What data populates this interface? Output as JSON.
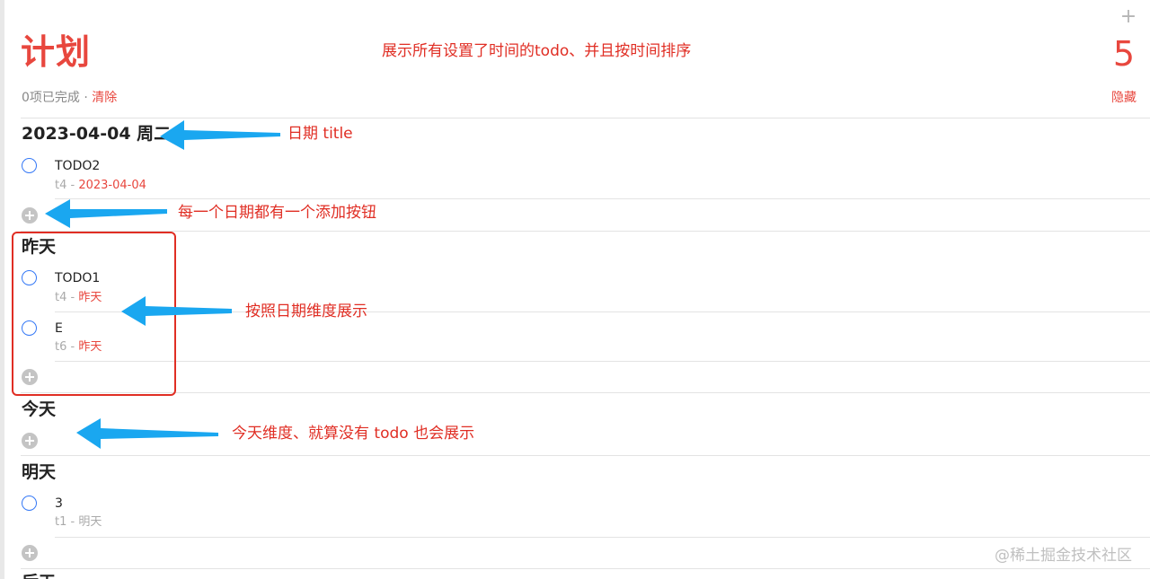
{
  "header": {
    "title": "计划",
    "count": "5",
    "add_icon": "plus-icon",
    "description_note": "展示所有设置了时间的todo、并且按时间排序"
  },
  "stats": {
    "completed_text": "0项已完成 · ",
    "clear_label": "清除",
    "hide_label": "隐藏"
  },
  "sections": [
    {
      "title": "2023-04-04 周二",
      "items": [
        {
          "title": "TODO2",
          "list": "t4",
          "sep": " - ",
          "date": "2023-04-04"
        }
      ]
    },
    {
      "title": "昨天",
      "items": [
        {
          "title": "TODO1",
          "list": "t4",
          "sep": " - ",
          "date": "昨天"
        },
        {
          "title": "E",
          "list": "t6",
          "sep": " - ",
          "date": "昨天"
        }
      ]
    },
    {
      "title": "今天",
      "items": []
    },
    {
      "title": "明天",
      "items": [
        {
          "title": "3",
          "list": "t1",
          "sep": " - ",
          "date": "明天"
        }
      ]
    },
    {
      "title": "后天",
      "items": []
    }
  ],
  "annotations": {
    "date_title": "日期 title",
    "add_button": "每一个日期都有一个添加按钮",
    "by_date": "按照日期维度展示",
    "today": "今天维度、就算没有 todo 也会展示"
  },
  "colors": {
    "accent": "#e8473e",
    "checkbox": "#3478f6",
    "annotation_arrow": "#1aa7f0",
    "annotation_text": "#e02e24"
  },
  "watermark": "@稀土掘金技术社区"
}
